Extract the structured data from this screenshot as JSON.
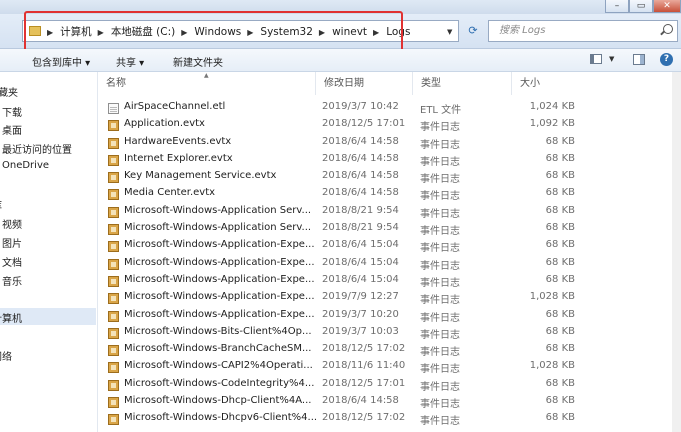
{
  "window": {
    "minimize_label": "–",
    "maximize_label": "▭",
    "close_label": "✕"
  },
  "address": {
    "crumbs": [
      "计算机",
      "本地磁盘 (C:)",
      "Windows",
      "System32",
      "winevt",
      "Logs"
    ],
    "search_placeholder": "搜索 Logs"
  },
  "toolbar": {
    "include_label": "包含到库中 ▾",
    "share_label": "共享 ▾",
    "new_folder_label": "新建文件夹"
  },
  "nav": {
    "items": [
      "收藏夹",
      "下载",
      "桌面",
      "最近访问的位置",
      "OneDrive",
      "库",
      "视频",
      "图片",
      "文档",
      "音乐",
      "计算机",
      "网络"
    ]
  },
  "columns": {
    "name": "名称",
    "modified": "修改日期",
    "type": "类型",
    "size": "大小"
  },
  "files": [
    {
      "name": "AirSpaceChannel.etl",
      "date": "2019/3/7 10:42",
      "type": "ETL 文件",
      "size": "1,024 KB",
      "icon": "etl-file-icon"
    },
    {
      "name": "Application.evtx",
      "date": "2018/12/5 17:01",
      "type": "事件日志",
      "size": "1,092 KB",
      "icon": "event-log-icon"
    },
    {
      "name": "HardwareEvents.evtx",
      "date": "2018/6/4 14:58",
      "type": "事件日志",
      "size": "68 KB",
      "icon": "event-log-icon"
    },
    {
      "name": "Internet Explorer.evtx",
      "date": "2018/6/4 14:58",
      "type": "事件日志",
      "size": "68 KB",
      "icon": "event-log-icon"
    },
    {
      "name": "Key Management Service.evtx",
      "date": "2018/6/4 14:58",
      "type": "事件日志",
      "size": "68 KB",
      "icon": "event-log-icon"
    },
    {
      "name": "Media Center.evtx",
      "date": "2018/6/4 14:58",
      "type": "事件日志",
      "size": "68 KB",
      "icon": "event-log-icon"
    },
    {
      "name": "Microsoft-Windows-Application Serv...",
      "date": "2018/8/21 9:54",
      "type": "事件日志",
      "size": "68 KB",
      "icon": "event-log-icon"
    },
    {
      "name": "Microsoft-Windows-Application Serv...",
      "date": "2018/8/21 9:54",
      "type": "事件日志",
      "size": "68 KB",
      "icon": "event-log-icon"
    },
    {
      "name": "Microsoft-Windows-Application-Expe...",
      "date": "2018/6/4 15:04",
      "type": "事件日志",
      "size": "68 KB",
      "icon": "event-log-icon"
    },
    {
      "name": "Microsoft-Windows-Application-Expe...",
      "date": "2018/6/4 15:04",
      "type": "事件日志",
      "size": "68 KB",
      "icon": "event-log-icon"
    },
    {
      "name": "Microsoft-Windows-Application-Expe...",
      "date": "2018/6/4 15:04",
      "type": "事件日志",
      "size": "68 KB",
      "icon": "event-log-icon"
    },
    {
      "name": "Microsoft-Windows-Application-Expe...",
      "date": "2019/7/9 12:27",
      "type": "事件日志",
      "size": "1,028 KB",
      "icon": "event-log-icon"
    },
    {
      "name": "Microsoft-Windows-Application-Expe...",
      "date": "2019/3/7 10:20",
      "type": "事件日志",
      "size": "68 KB",
      "icon": "event-log-icon"
    },
    {
      "name": "Microsoft-Windows-Bits-Client%4Op...",
      "date": "2019/3/7 10:03",
      "type": "事件日志",
      "size": "68 KB",
      "icon": "event-log-icon"
    },
    {
      "name": "Microsoft-Windows-BranchCacheSM...",
      "date": "2018/12/5 17:02",
      "type": "事件日志",
      "size": "68 KB",
      "icon": "event-log-icon"
    },
    {
      "name": "Microsoft-Windows-CAPI2%4Operati...",
      "date": "2018/11/6 11:40",
      "type": "事件日志",
      "size": "1,028 KB",
      "icon": "event-log-icon"
    },
    {
      "name": "Microsoft-Windows-CodeIntegrity%4...",
      "date": "2018/12/5 17:01",
      "type": "事件日志",
      "size": "68 KB",
      "icon": "event-log-icon"
    },
    {
      "name": "Microsoft-Windows-Dhcp-Client%4A...",
      "date": "2018/6/4 14:58",
      "type": "事件日志",
      "size": "68 KB",
      "icon": "event-log-icon"
    },
    {
      "name": "Microsoft-Windows-Dhcpv6-Client%4...",
      "date": "2018/12/5 17:02",
      "type": "事件日志",
      "size": "68 KB",
      "icon": "event-log-icon"
    }
  ]
}
